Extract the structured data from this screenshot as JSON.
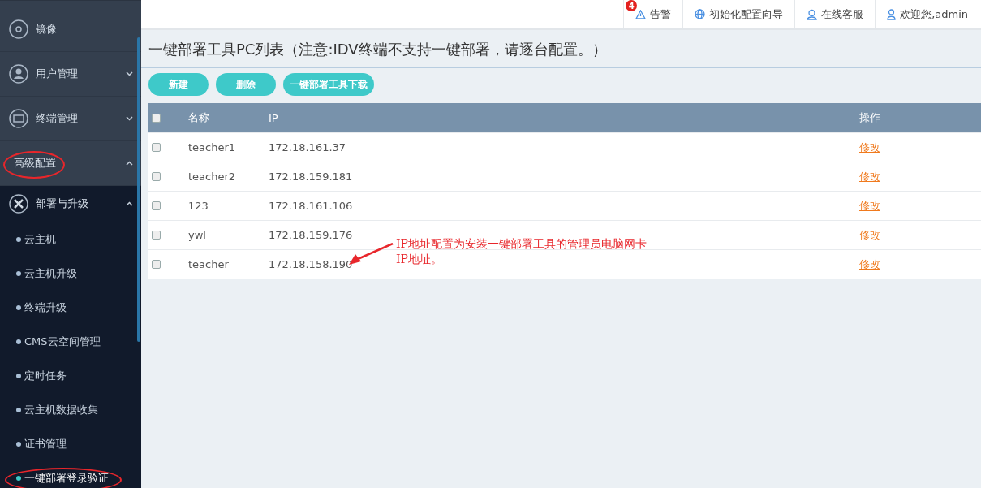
{
  "sidebar": {
    "items": [
      {
        "label": "镜像",
        "kind": "disc",
        "circled": false
      },
      {
        "label": "用户管理",
        "kind": "user",
        "expanded": false,
        "circled": false,
        "chevron": true
      },
      {
        "label": "终端管理",
        "kind": "terminal",
        "expanded": false,
        "circled": false,
        "chevron": true
      },
      {
        "label": "高级配置",
        "kind": "plain",
        "expanded": true,
        "circled": true,
        "chevron": true,
        "children": [
          {
            "label": "部署与升级",
            "kind": "tools",
            "expanded": true,
            "circled": false,
            "chevron": true,
            "children": [
              {
                "label": "云主机",
                "selected": false,
                "circled": false
              },
              {
                "label": "云主机升级",
                "selected": false,
                "circled": false
              },
              {
                "label": "终端升级",
                "selected": false,
                "circled": false
              },
              {
                "label": "CMS云空间管理",
                "selected": false,
                "circled": false
              },
              {
                "label": "定时任务",
                "selected": false,
                "circled": false
              },
              {
                "label": "云主机数据收集",
                "selected": false,
                "circled": false
              },
              {
                "label": "证书管理",
                "selected": false,
                "circled": false
              },
              {
                "label": "一键部署登录验证",
                "selected": true,
                "circled": true
              }
            ]
          }
        ]
      }
    ]
  },
  "topbar": [
    {
      "label": "告警",
      "kind": "warning",
      "badge": "4"
    },
    {
      "label": "初始化配置向导",
      "kind": "globe"
    },
    {
      "label": "在线客服",
      "kind": "headset"
    },
    {
      "label": "欢迎您,admin",
      "kind": "user"
    }
  ],
  "page_title": "一键部署工具PC列表（注意:IDV终端不支持一键部署，请逐台配置。）",
  "buttons": [
    "新建",
    "删除",
    "一键部署工具下载"
  ],
  "table": {
    "select_all_checked": false,
    "columns": [
      "名称",
      "IP",
      "操作"
    ],
    "rows": [
      {
        "checked": false,
        "name": "teacher1",
        "ip": "172.18.161.37",
        "action": "修改"
      },
      {
        "checked": false,
        "name": "teacher2",
        "ip": "172.18.159.181",
        "action": "修改"
      },
      {
        "checked": false,
        "name": "123",
        "ip": "172.18.161.106",
        "action": "修改"
      },
      {
        "checked": false,
        "name": "ywl",
        "ip": "172.18.159.176",
        "action": "修改"
      },
      {
        "checked": false,
        "name": "teacher",
        "ip": "172.18.158.190",
        "action": "修改"
      }
    ]
  },
  "annotation": {
    "lines": [
      "IP地址配置为安装一键部署工具的管理员电脑网卡",
      "IP地址。"
    ]
  }
}
